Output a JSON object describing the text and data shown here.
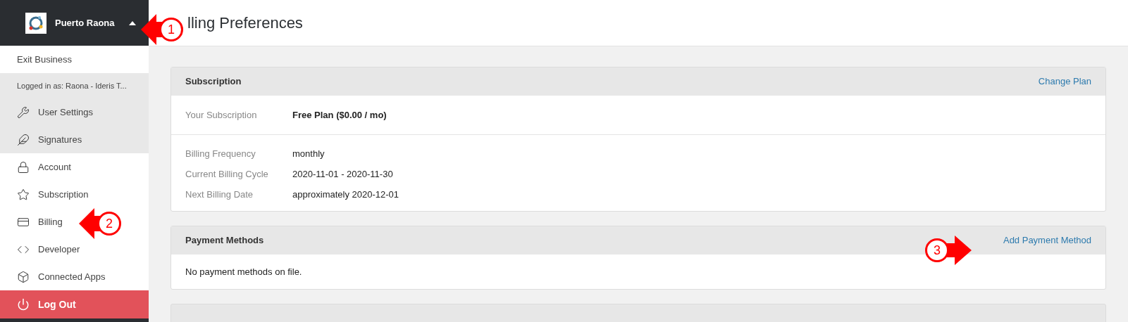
{
  "business_menu": {
    "name": "Puerto Raona",
    "expanded": true,
    "exit_label": "Exit Business",
    "logged_in": "Logged in as: Raona - Ideris T...",
    "user_items": [
      {
        "label": "User Settings"
      },
      {
        "label": "Signatures"
      }
    ],
    "business_items": [
      {
        "label": "Account"
      },
      {
        "label": "Subscription"
      },
      {
        "label": "Billing"
      },
      {
        "label": "Developer"
      },
      {
        "label": "Connected Apps"
      }
    ],
    "logout": "Log Out"
  },
  "page_title": "lling Preferences",
  "subscription_card": {
    "title": "Subscription",
    "action": "Change Plan",
    "plan_row": {
      "label": "Your Subscription",
      "value": "Free Plan ($0.00 / mo)"
    },
    "rows": [
      {
        "label": "Billing Frequency",
        "value": "monthly"
      },
      {
        "label": "Current Billing Cycle",
        "value": "2020-11-01 - 2020-11-30"
      },
      {
        "label": "Next Billing Date",
        "value": "approximately 2020-12-01"
      }
    ]
  },
  "payment_card": {
    "title": "Payment Methods",
    "action": "Add Payment Method",
    "empty": "No payment methods on file."
  },
  "annotations": [
    {
      "label": "1"
    },
    {
      "label": "2"
    },
    {
      "label": "3"
    }
  ]
}
